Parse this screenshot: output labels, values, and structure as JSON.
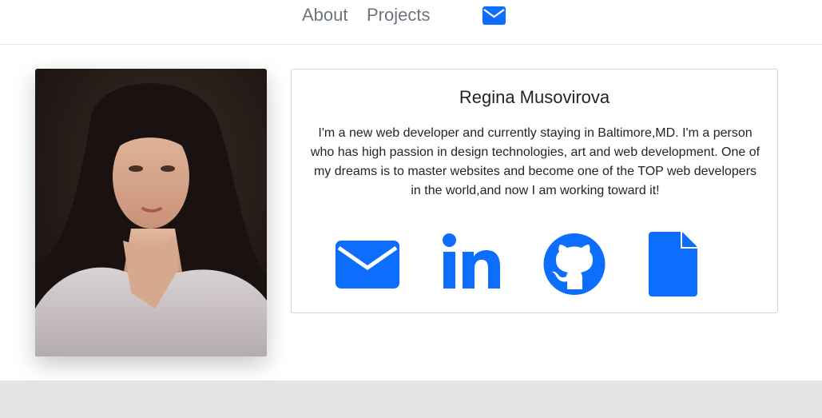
{
  "nav": {
    "about_label": "About",
    "projects_label": "Projects",
    "contact_icon": "envelope-icon"
  },
  "profile": {
    "photo": "portrait-photo",
    "name": "Regina Musovirova",
    "bio": "I'm a new web developer and currently staying in Baltimore,MD. I'm a person who has high passion in design technologies, art and web development. One of my dreams is to master websites and become one of the TOP web developers in the world,and now I am working toward it!"
  },
  "social_links": [
    {
      "icon": "envelope-icon"
    },
    {
      "icon": "linkedin-icon"
    },
    {
      "icon": "github-icon"
    },
    {
      "icon": "file-icon"
    }
  ],
  "colors": {
    "accent": "#0d6efd",
    "nav_text": "#6c757d",
    "body_text": "#212529",
    "footer_bg": "#e5e5e5",
    "card_border": "#d6d6d6"
  }
}
